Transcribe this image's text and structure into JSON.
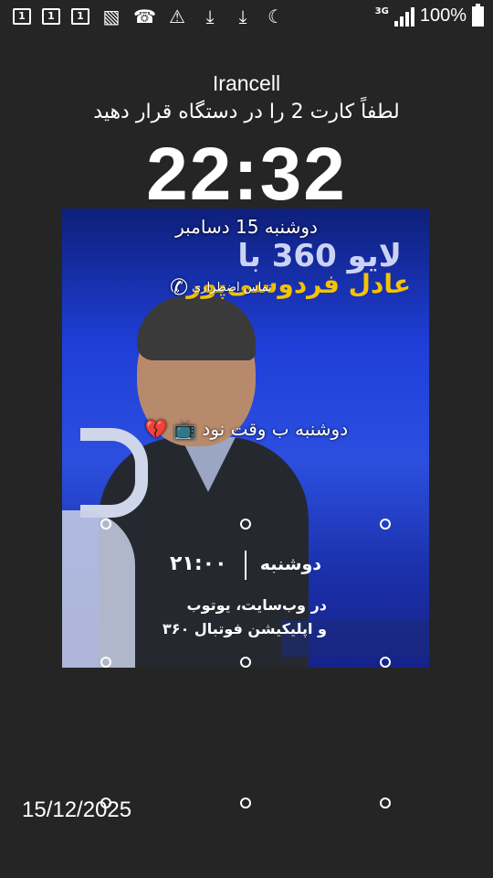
{
  "status_bar": {
    "notification_icons": [
      "sim-1-icon",
      "sim-1-icon",
      "sim-1-icon",
      "image-icon",
      "missed-call-icon",
      "warning-icon",
      "download-icon",
      "download-icon",
      "moon-icon"
    ],
    "sim_label": "1",
    "network_type": "3G",
    "battery": "100%"
  },
  "lockscreen": {
    "carrier": "Irancell",
    "sim_message": "لطفاً کارت 2 را در دستگاه قرار دهید",
    "time": "22:32",
    "date": "دوشنبه 15 دسامبر",
    "emergency_label": "تماس اضطراری",
    "owner_info_text": "دوشنبه ب وقت نود",
    "owner_info_emoji_1": "📺",
    "owner_info_emoji_2": "💔",
    "footer_date": "15/12/2025"
  },
  "wallpaper": {
    "title": "لایو 360 با",
    "name": "عادل فردوسی‌پور",
    "day": "دوشنبه",
    "time": "۲۱:۰۰",
    "info_line_1": "در وب‌سایت، یوتوب",
    "info_line_2": "و اپلیکیشن فوتبال ۳۶۰"
  },
  "colors": {
    "background": "#252525",
    "wallpaper_accent": "#f5c300",
    "wallpaper_blue": "#1f3fd8"
  }
}
